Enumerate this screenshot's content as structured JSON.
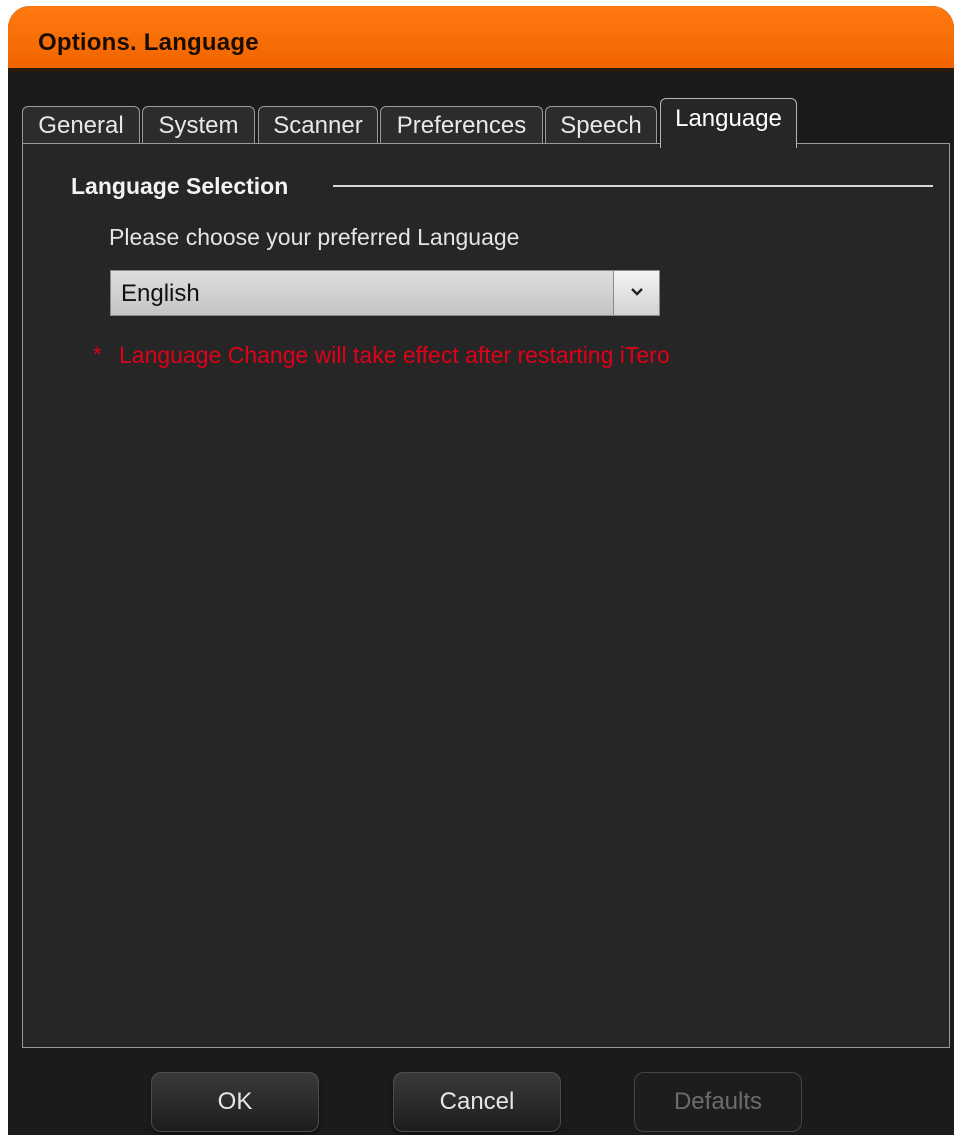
{
  "window": {
    "title": "Options. Language"
  },
  "tabs": [
    {
      "label": "General",
      "active": false
    },
    {
      "label": "System",
      "active": false
    },
    {
      "label": "Scanner",
      "active": false
    },
    {
      "label": "Preferences",
      "active": false
    },
    {
      "label": "Speech",
      "active": false
    },
    {
      "label": "Language",
      "active": true
    }
  ],
  "language_section": {
    "group_label": "Language Selection",
    "prompt": "Please choose your preferred Language",
    "selected_language": "English",
    "note_marker": "*",
    "note_text": "Language Change will take effect after restarting iTero"
  },
  "footer": {
    "ok_label": "OK",
    "cancel_label": "Cancel",
    "defaults_label": "Defaults",
    "defaults_enabled": false
  },
  "colors": {
    "title_bar": "#f06400",
    "background": "#1b1b1b",
    "panel": "#262626",
    "warning_text": "#e00018"
  },
  "icons": {
    "dropdown": "chevron-down-icon"
  }
}
